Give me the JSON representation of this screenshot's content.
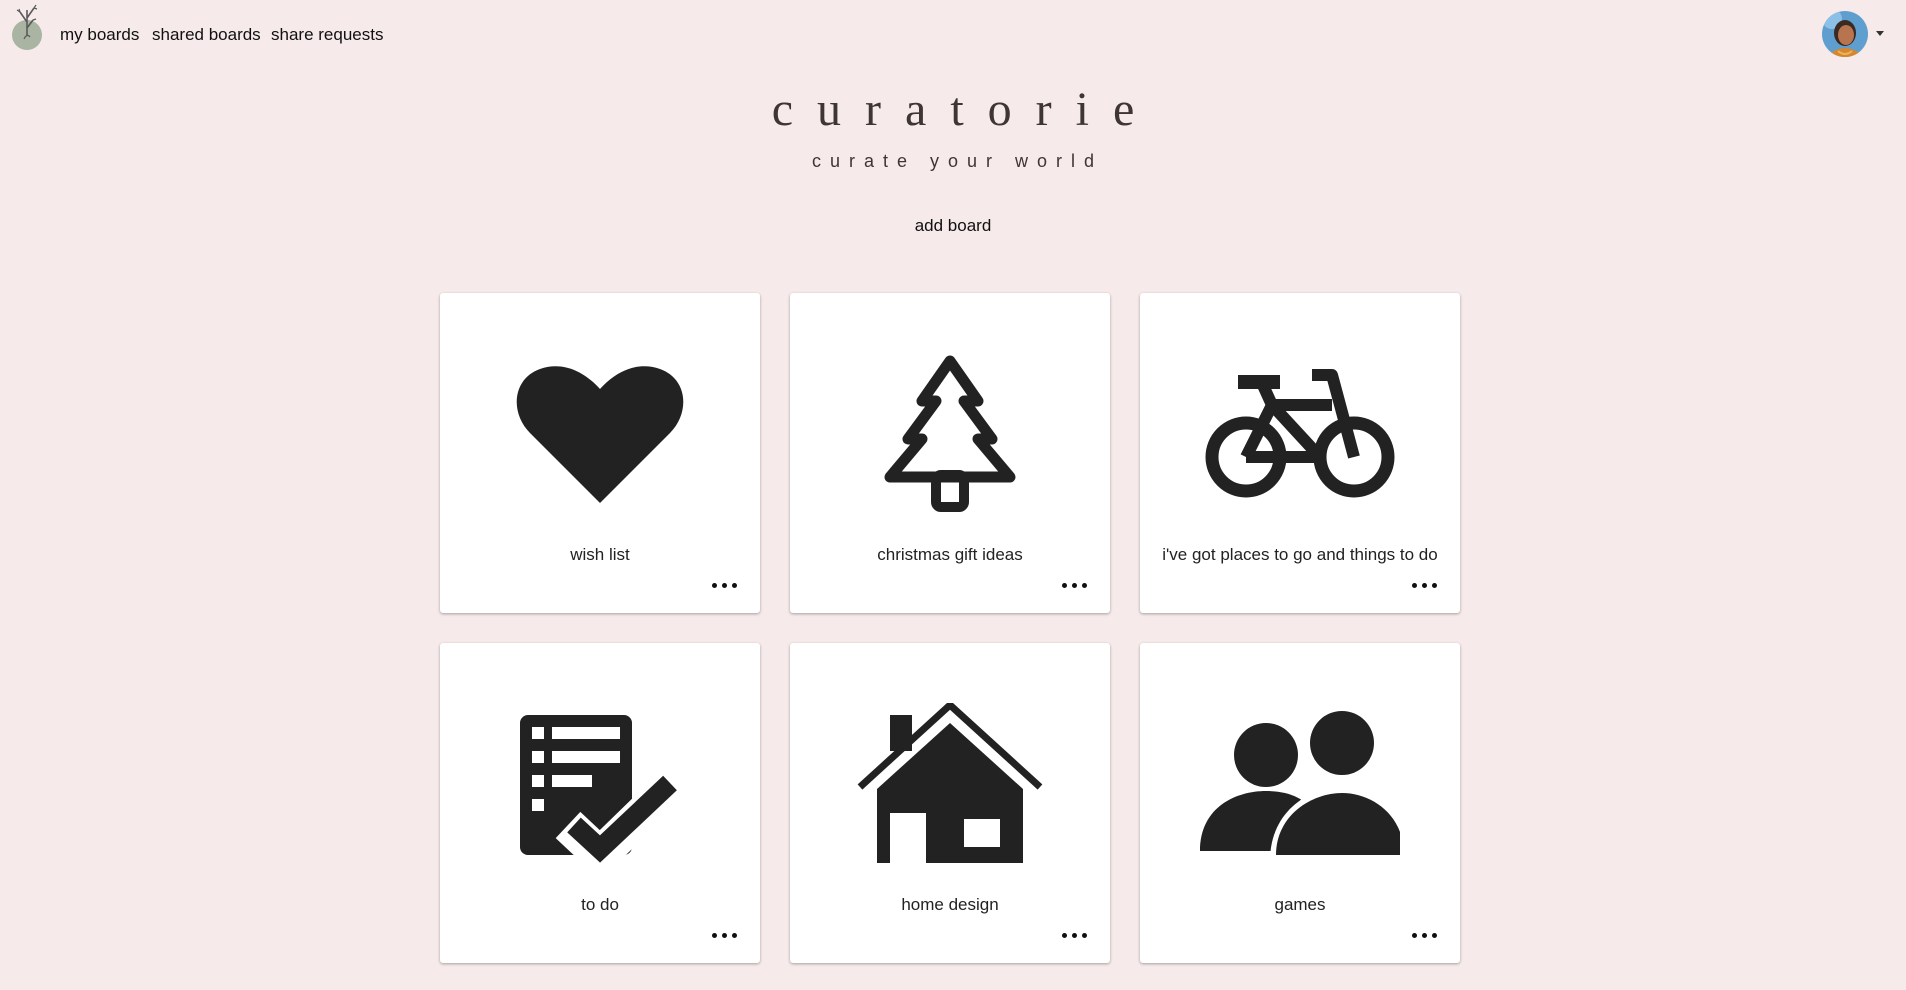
{
  "nav": {
    "logo_icon": "leaf-pot-icon",
    "links": [
      {
        "label": "my boards"
      },
      {
        "label": "shared boards"
      },
      {
        "label": "share requests"
      }
    ],
    "avatar_icon": "user-avatar",
    "caret_icon": "caret-down-icon"
  },
  "brand": {
    "title": "curatorie",
    "tagline": "curate your world"
  },
  "actions": {
    "add_board": "add board"
  },
  "boards": [
    {
      "label": "wish list",
      "icon": "heart-icon"
    },
    {
      "label": "christmas gift ideas",
      "icon": "tree-icon"
    },
    {
      "label": "i've got places to go and things to do",
      "icon": "bicycle-icon"
    },
    {
      "label": "to do",
      "icon": "checklist-icon"
    },
    {
      "label": "home design",
      "icon": "house-icon"
    },
    {
      "label": "games",
      "icon": "people-icon"
    }
  ],
  "colors": {
    "background": "#f6eaea",
    "card": "#ffffff",
    "icon": "#222222",
    "brand_text": "#3e3535"
  }
}
